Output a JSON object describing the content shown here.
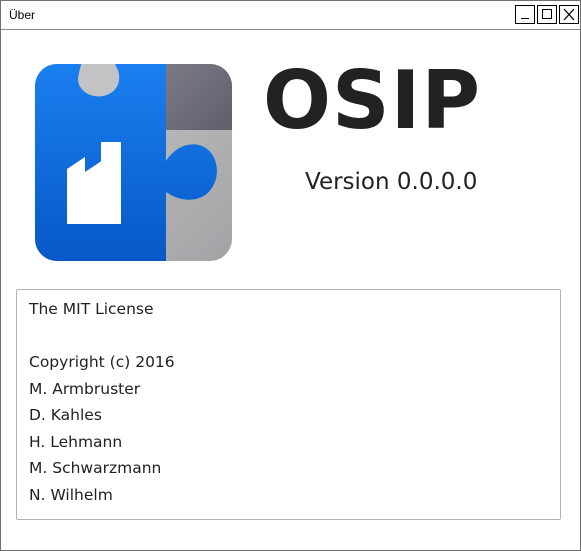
{
  "window": {
    "title": "Über",
    "controls": {
      "minimize": "minimize",
      "maximize": "maximize",
      "close": "close"
    }
  },
  "app": {
    "name": "OSIP",
    "version_line": "Version 0.0.0.0",
    "icon": "puzzle-factory-icon",
    "colors": {
      "blue": "#0a66d8",
      "gray": "#b4b4b7",
      "dark_gray": "#6d6d7a"
    }
  },
  "license": {
    "lines": [
      "The MIT License",
      "",
      "Copyright (c) 2016",
      "M. Armbruster",
      "D. Kahles",
      "H. Lehmann",
      "M. Schwarzmann",
      "N. Wilhelm"
    ]
  }
}
